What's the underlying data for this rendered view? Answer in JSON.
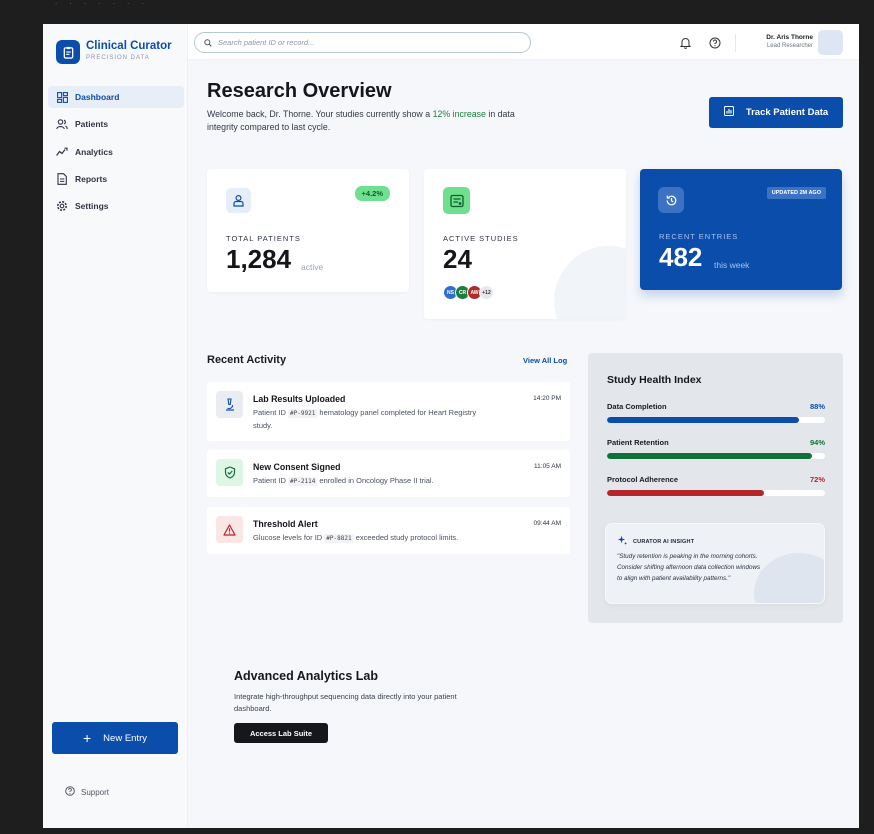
{
  "brand": {
    "title": "Clinical Curator",
    "subtitle": "PRECISION DATA"
  },
  "sidebar": {
    "items": [
      {
        "label": "Dashboard",
        "icon": "grid-icon",
        "active": true
      },
      {
        "label": "Patients",
        "icon": "users-icon"
      },
      {
        "label": "Analytics",
        "icon": "analytics-icon"
      },
      {
        "label": "Reports",
        "icon": "document-icon"
      },
      {
        "label": "Settings",
        "icon": "gear-icon"
      }
    ],
    "new_entry_label": "New Entry",
    "support_label": "Support"
  },
  "topbar": {
    "search_placeholder": "Search patient ID or record...",
    "user_name": "Dr. Aris Thorne",
    "user_role": "Lead Researcher"
  },
  "header": {
    "title": "Research Overview",
    "welcome_prefix": "Welcome back, Dr. Thorne. Your studies currently show a",
    "welcome_highlight": "12% increase",
    "welcome_suffix": "in data integrity compared to last cycle.",
    "track_button": "Track Patient Data"
  },
  "stats": {
    "total_patients": {
      "label": "TOTAL PATIENTS",
      "value": "1,284",
      "unit": "active",
      "badge": "+4.2%"
    },
    "active_studies": {
      "label": "ACTIVE STUDIES",
      "value": "24",
      "avatars": [
        {
          "initials": "NS",
          "color": "#2f6fd1"
        },
        {
          "initials": "CR",
          "color": "#1a7f3c"
        },
        {
          "initials": "AW",
          "color": "#b02a2a"
        },
        {
          "initials": "+12",
          "color": "#e5e8ed"
        }
      ]
    },
    "recent_entries": {
      "label": "RECENT ENTRIES",
      "value": "482",
      "unit": "this week",
      "badge": "UPDATED 2M AGO"
    }
  },
  "activity": {
    "title": "Recent Activity",
    "view_all": "View All Log",
    "items": [
      {
        "title": "Lab Results Uploaded",
        "desc_pre": "Patient ID",
        "code": "#P-9921",
        "desc_post": "hematology panel completed for Heart Registry study.",
        "time": "14:20 PM",
        "icon": "microscope-icon",
        "tone": "neutral"
      },
      {
        "title": "New Consent Signed",
        "desc_pre": "Patient ID",
        "code": "#P-2114",
        "desc_post": "enrolled in Oncology Phase II trial.",
        "time": "11:05 AM",
        "icon": "shield-check-icon",
        "tone": "success"
      },
      {
        "title": "Threshold Alert",
        "desc_pre": "Glucose levels for ID",
        "code": "#P-8821",
        "desc_post": "exceeded study protocol limits.",
        "time": "09:44 AM",
        "icon": "warning-icon",
        "tone": "danger"
      }
    ]
  },
  "health": {
    "title": "Study Health Index",
    "metrics": [
      {
        "label": "Data Completion",
        "value": "88%",
        "fraction": 0.88,
        "color": "#0b4dab"
      },
      {
        "label": "Patient Retention",
        "value": "94%",
        "fraction": 0.94,
        "color": "#11703a"
      },
      {
        "label": "Protocol Adherence",
        "value": "72%",
        "fraction": 0.72,
        "color": "#b3262a"
      }
    ],
    "insight_title": "CURATOR AI INSIGHT",
    "insight_text": "\"Study retention is peaking in the morning cohorts. Consider shifting afternoon data collection windows to align with patient availability patterns.\""
  },
  "advanced": {
    "title": "Advanced Analytics Lab",
    "desc": "Integrate high-throughput sequencing data directly into your patient dashboard.",
    "button": "Access Lab Suite"
  }
}
